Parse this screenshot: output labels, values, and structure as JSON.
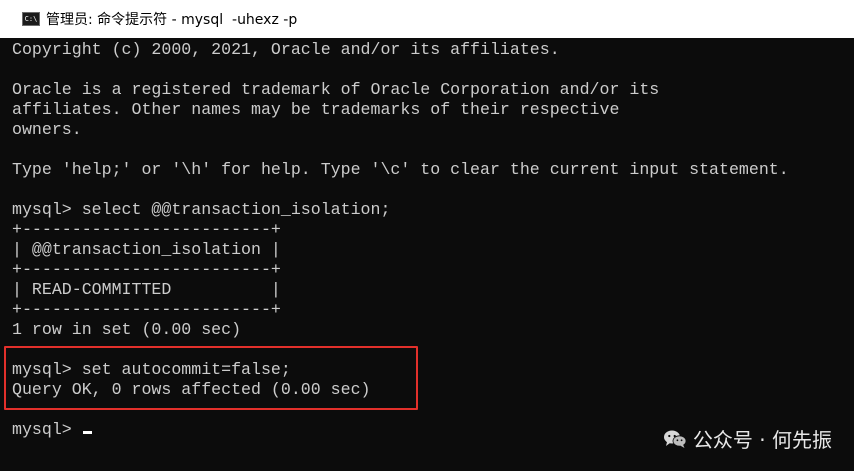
{
  "window": {
    "icon_label": "C:\\",
    "title": "管理员: 命令提示符 - mysql  -uhexz -p"
  },
  "console": {
    "lines": [
      "Copyright (c) 2000, 2021, Oracle and/or its affiliates.",
      "",
      "Oracle is a registered trademark of Oracle Corporation and/or its",
      "affiliates. Other names may be trademarks of their respective",
      "owners.",
      "",
      "Type 'help;' or '\\h' for help. Type '\\c' to clear the current input statement.",
      "",
      "mysql> select @@transaction_isolation;",
      "+-------------------------+",
      "| @@transaction_isolation |",
      "+-------------------------+",
      "| READ-COMMITTED          |",
      "+-------------------------+",
      "1 row in set (0.00 sec)",
      "",
      "mysql> set autocommit=false;",
      "Query OK, 0 rows affected (0.00 sec)",
      "",
      "mysql> "
    ]
  },
  "watermark": {
    "text": "公众号 · 何先振",
    "icon": "wechat-icon"
  },
  "colors": {
    "console_bg": "#0c0c0c",
    "console_fg": "#cccccc",
    "highlight_border": "#e3302b"
  }
}
